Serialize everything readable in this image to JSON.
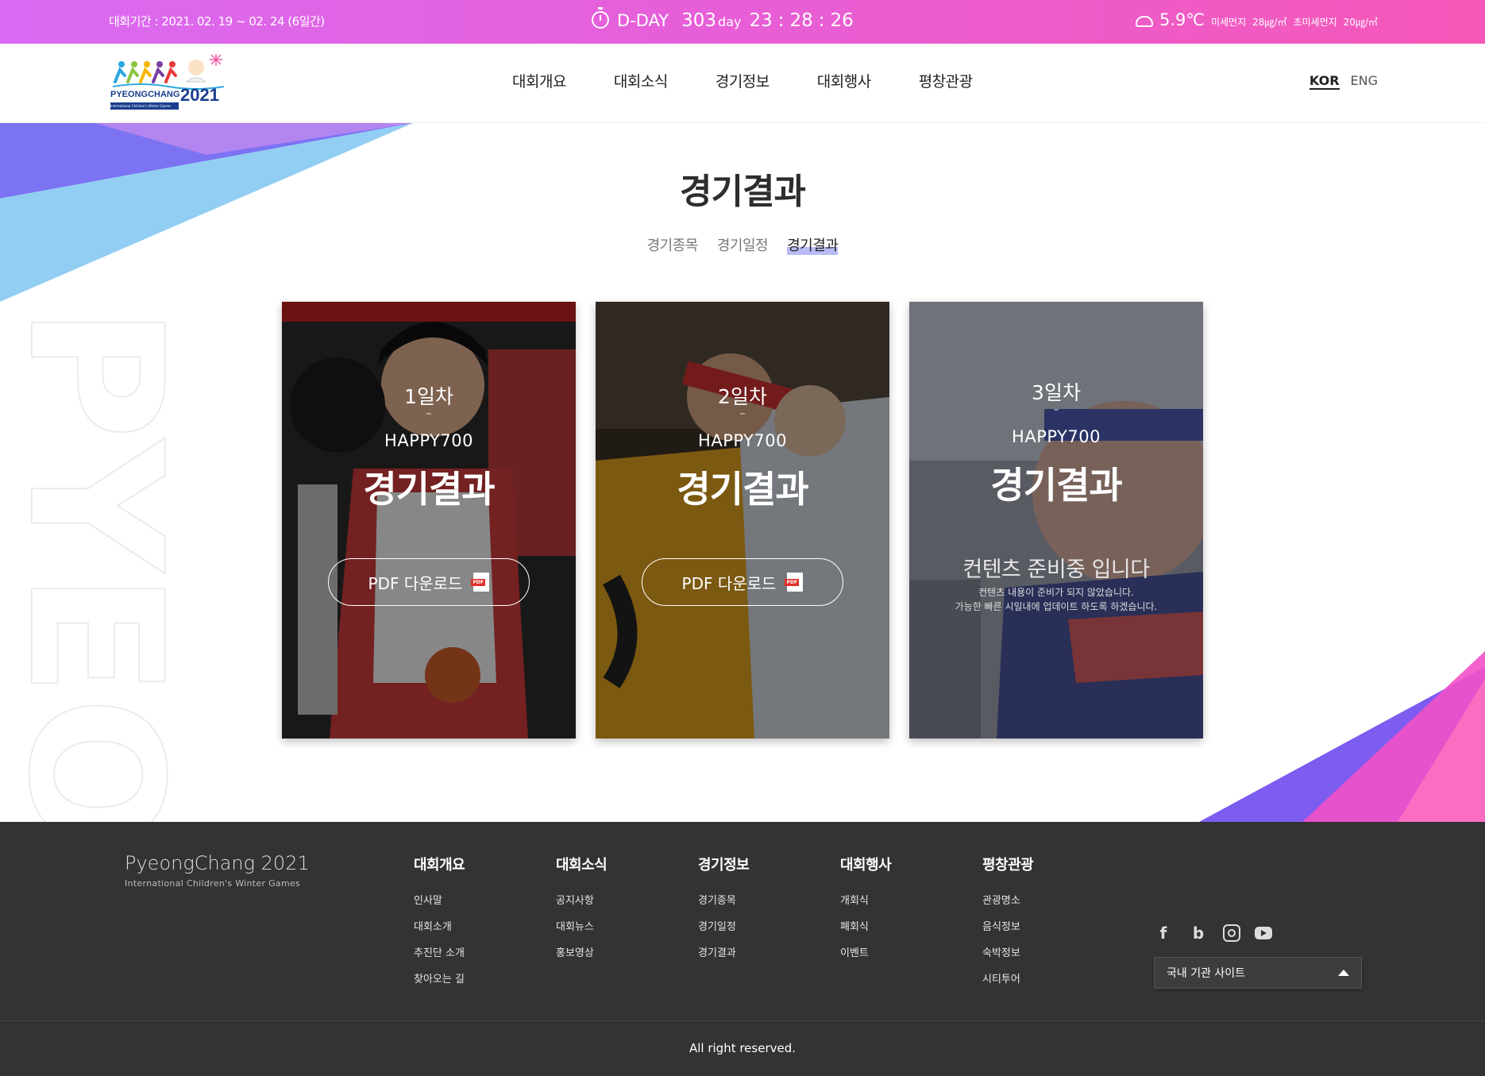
{
  "topbar": {
    "period": "대회기간 : 2021. 02. 19 ~ 02. 24 (6일간)",
    "dday_label": "D-DAY",
    "dday_number": "303",
    "dday_unit": "day",
    "hours": "23",
    "minutes": "28",
    "seconds": "26",
    "temperature": "5.9℃",
    "pm10_label": "미세먼지",
    "pm10_value": "28㎍/㎥",
    "pm25_label": "초미세먼지",
    "pm25_value": "20㎍/㎥"
  },
  "header": {
    "logo_text": "PYEONGCHANG",
    "logo_year": "2021",
    "logo_sub": "International Children's Winter Games",
    "nav": [
      "대회개요",
      "대회소식",
      "경기정보",
      "대회행사",
      "평창관광"
    ],
    "lang_active": "KOR",
    "lang_other": "ENG"
  },
  "page": {
    "title": "경기결과",
    "subnav": [
      "경기종목",
      "경기일정",
      "경기결과"
    ],
    "bg_watermark": "PYEO"
  },
  "cards": [
    {
      "day": "1일차",
      "dash": "–",
      "brand": "HAPPY700",
      "result": "경기결과",
      "button": "PDF 다운로드"
    },
    {
      "day": "2일차",
      "dash": "–",
      "brand": "HAPPY700",
      "result": "경기결과",
      "button": "PDF 다운로드"
    },
    {
      "day": "3일차",
      "dash": "–",
      "brand": "HAPPY700",
      "result": "경기결과",
      "prep_title": "컨텐츠 준비중 입니다",
      "prep_line1": "컨텐츠 내용이 준비가 되지 않았습니다.",
      "prep_line2": "가능한 빠른 시일내에 업데이트 하도록 하겠습니다."
    }
  ],
  "footer": {
    "brand": "PyeongChang 2021",
    "brand_sub": "International Children's Winter Games",
    "columns": [
      {
        "title": "대회개요",
        "items": [
          "인사말",
          "대회소개",
          "추진단 소개",
          "찾아오는 길"
        ]
      },
      {
        "title": "대회소식",
        "items": [
          "공지사항",
          "대회뉴스",
          "홍보영상"
        ]
      },
      {
        "title": "경기정보",
        "items": [
          "경기종목",
          "경기일정",
          "경기결과"
        ]
      },
      {
        "title": "대회행사",
        "items": [
          "개회식",
          "폐회식",
          "이벤트"
        ]
      },
      {
        "title": "평창관광",
        "items": [
          "관광명소",
          "음식정보",
          "숙박정보",
          "시티투어"
        ]
      }
    ],
    "sns": [
      "facebook-icon",
      "blog-icon",
      "instagram-icon",
      "youtube-icon"
    ],
    "site_select": "국내 기관 사이트",
    "copyright": "All right reserved."
  },
  "colors": {
    "topbar_start": "#d96bf2",
    "topbar_end": "#f558b8",
    "footer_bg": "#333333",
    "subnav_highlight": "#b7bcf5"
  }
}
